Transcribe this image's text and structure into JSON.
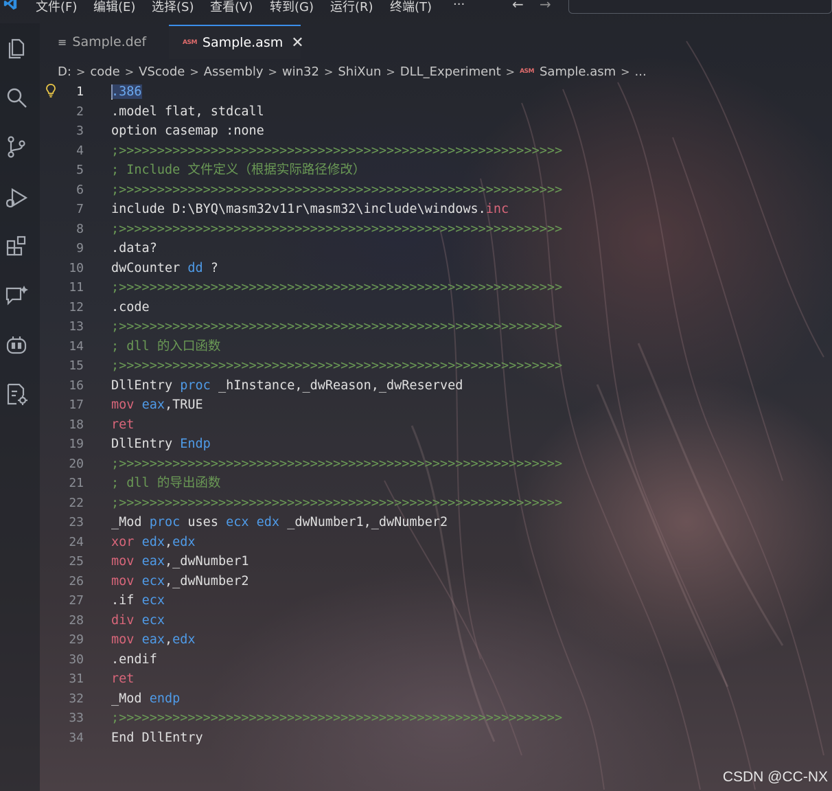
{
  "menu": {
    "items": [
      "文件(F)",
      "编辑(E)",
      "选择(S)",
      "查看(V)",
      "转到(G)",
      "运行(R)",
      "终端(T)",
      "···"
    ],
    "back": "←",
    "forward": "→"
  },
  "tabs": [
    {
      "label": "Sample.def",
      "active": false
    },
    {
      "label": "Sample.asm",
      "active": true,
      "badge": "ASM",
      "close": "✕"
    }
  ],
  "breadcrumb": {
    "items": [
      "D:",
      "code",
      "VScode",
      "Assembly",
      "win32",
      "ShiXun",
      "DLL_Experiment",
      "Sample.asm",
      "..."
    ],
    "separator": ">",
    "file_badge": "ASM"
  },
  "editor": {
    "current_line": 1,
    "lines": [
      {
        "n": "1",
        "tokens": [
          {
            "t": ".386",
            "c": "num",
            "sel": true
          }
        ]
      },
      {
        "n": "2",
        "tokens": [
          {
            "t": ".model flat, stdcall",
            "c": "plain"
          }
        ]
      },
      {
        "n": "3",
        "tokens": [
          {
            "t": "option casemap :none",
            "c": "plain"
          }
        ]
      },
      {
        "n": "4",
        "tokens": [
          {
            "t": ";>>>>>>>>>>>>>>>>>>>>>>>>>>>>>>>>>>>>>>>>>>>>>>>>>>>>>>>>>>",
            "c": "comment"
          }
        ]
      },
      {
        "n": "5",
        "tokens": [
          {
            "t": "; Include 文件定义（根据实际路径修改）",
            "c": "comment"
          }
        ]
      },
      {
        "n": "6",
        "tokens": [
          {
            "t": ";>>>>>>>>>>>>>>>>>>>>>>>>>>>>>>>>>>>>>>>>>>>>>>>>>>>>>>>>>>",
            "c": "comment"
          }
        ]
      },
      {
        "n": "7",
        "tokens": [
          {
            "t": "include D:\\BYQ\\masm32v11r\\masm32\\include\\windows.",
            "c": "plain"
          },
          {
            "t": "inc",
            "c": "ins"
          }
        ]
      },
      {
        "n": "8",
        "tokens": [
          {
            "t": ";>>>>>>>>>>>>>>>>>>>>>>>>>>>>>>>>>>>>>>>>>>>>>>>>>>>>>>>>>>",
            "c": "comment"
          }
        ]
      },
      {
        "n": "9",
        "tokens": [
          {
            "t": ".data?",
            "c": "plain"
          }
        ]
      },
      {
        "n": "10",
        "tokens": [
          {
            "t": "dwCounter ",
            "c": "plain"
          },
          {
            "t": "dd",
            "c": "kw"
          },
          {
            "t": " ?",
            "c": "plain"
          }
        ]
      },
      {
        "n": "11",
        "tokens": [
          {
            "t": ";>>>>>>>>>>>>>>>>>>>>>>>>>>>>>>>>>>>>>>>>>>>>>>>>>>>>>>>>>>",
            "c": "comment"
          }
        ]
      },
      {
        "n": "12",
        "tokens": [
          {
            "t": ".code",
            "c": "plain"
          }
        ]
      },
      {
        "n": "13",
        "tokens": [
          {
            "t": ";>>>>>>>>>>>>>>>>>>>>>>>>>>>>>>>>>>>>>>>>>>>>>>>>>>>>>>>>>>",
            "c": "comment"
          }
        ]
      },
      {
        "n": "14",
        "tokens": [
          {
            "t": "; dll 的入口函数",
            "c": "comment"
          }
        ]
      },
      {
        "n": "15",
        "tokens": [
          {
            "t": ";>>>>>>>>>>>>>>>>>>>>>>>>>>>>>>>>>>>>>>>>>>>>>>>>>>>>>>>>>>",
            "c": "comment"
          }
        ]
      },
      {
        "n": "16",
        "tokens": [
          {
            "t": "DllEntry ",
            "c": "plain"
          },
          {
            "t": "proc",
            "c": "kw"
          },
          {
            "t": " _hInstance,_dwReason,_dwReserved",
            "c": "plain"
          }
        ]
      },
      {
        "n": "17",
        "tokens": [
          {
            "t": "mov",
            "c": "ins"
          },
          {
            "t": " ",
            "c": "plain"
          },
          {
            "t": "eax",
            "c": "kw"
          },
          {
            "t": ",TRUE",
            "c": "plain"
          }
        ]
      },
      {
        "n": "18",
        "tokens": [
          {
            "t": "ret",
            "c": "ins"
          }
        ]
      },
      {
        "n": "19",
        "tokens": [
          {
            "t": "DllEntry ",
            "c": "plain"
          },
          {
            "t": "Endp",
            "c": "kw"
          }
        ]
      },
      {
        "n": "20",
        "tokens": [
          {
            "t": ";>>>>>>>>>>>>>>>>>>>>>>>>>>>>>>>>>>>>>>>>>>>>>>>>>>>>>>>>>>",
            "c": "comment"
          }
        ]
      },
      {
        "n": "21",
        "tokens": [
          {
            "t": "; dll 的导出函数",
            "c": "comment"
          }
        ]
      },
      {
        "n": "22",
        "tokens": [
          {
            "t": ";>>>>>>>>>>>>>>>>>>>>>>>>>>>>>>>>>>>>>>>>>>>>>>>>>>>>>>>>>>",
            "c": "comment"
          }
        ]
      },
      {
        "n": "23",
        "tokens": [
          {
            "t": "_Mod ",
            "c": "plain"
          },
          {
            "t": "proc",
            "c": "kw"
          },
          {
            "t": " uses ",
            "c": "plain"
          },
          {
            "t": "ecx",
            "c": "kw"
          },
          {
            "t": " ",
            "c": "plain"
          },
          {
            "t": "edx",
            "c": "kw"
          },
          {
            "t": " _dwNumber1,_dwNumber2",
            "c": "plain"
          }
        ]
      },
      {
        "n": "24",
        "tokens": [
          {
            "t": "xor",
            "c": "ins"
          },
          {
            "t": " ",
            "c": "plain"
          },
          {
            "t": "edx",
            "c": "kw"
          },
          {
            "t": ",",
            "c": "plain"
          },
          {
            "t": "edx",
            "c": "kw"
          }
        ]
      },
      {
        "n": "25",
        "tokens": [
          {
            "t": "mov",
            "c": "ins"
          },
          {
            "t": " ",
            "c": "plain"
          },
          {
            "t": "eax",
            "c": "kw"
          },
          {
            "t": ",_dwNumber1",
            "c": "plain"
          }
        ]
      },
      {
        "n": "26",
        "tokens": [
          {
            "t": "mov",
            "c": "ins"
          },
          {
            "t": " ",
            "c": "plain"
          },
          {
            "t": "ecx",
            "c": "kw"
          },
          {
            "t": ",_dwNumber2",
            "c": "plain"
          }
        ]
      },
      {
        "n": "27",
        "tokens": [
          {
            "t": ".if ",
            "c": "plain"
          },
          {
            "t": "ecx",
            "c": "kw"
          }
        ]
      },
      {
        "n": "28",
        "tokens": [
          {
            "t": "div",
            "c": "ins"
          },
          {
            "t": " ",
            "c": "plain"
          },
          {
            "t": "ecx",
            "c": "kw"
          }
        ]
      },
      {
        "n": "29",
        "tokens": [
          {
            "t": "mov",
            "c": "ins"
          },
          {
            "t": " ",
            "c": "plain"
          },
          {
            "t": "eax",
            "c": "kw"
          },
          {
            "t": ",",
            "c": "plain"
          },
          {
            "t": "edx",
            "c": "kw"
          }
        ]
      },
      {
        "n": "30",
        "tokens": [
          {
            "t": ".endif",
            "c": "plain"
          }
        ]
      },
      {
        "n": "31",
        "tokens": [
          {
            "t": "ret",
            "c": "ins"
          }
        ]
      },
      {
        "n": "32",
        "tokens": [
          {
            "t": "_Mod ",
            "c": "plain"
          },
          {
            "t": "endp",
            "c": "kw"
          }
        ]
      },
      {
        "n": "33",
        "tokens": [
          {
            "t": ";>>>>>>>>>>>>>>>>>>>>>>>>>>>>>>>>>>>>>>>>>>>>>>>>>>>>>>>>>>",
            "c": "comment"
          }
        ]
      },
      {
        "n": "34",
        "tokens": [
          {
            "t": "End DllEntry",
            "c": "plain"
          }
        ]
      }
    ]
  },
  "activity_icons": [
    "explorer-icon",
    "search-icon",
    "source-control-icon",
    "run-debug-icon",
    "extensions-icon",
    "chat-icon",
    "copilot-icon",
    "remote-settings-icon"
  ],
  "watermark": "CSDN @CC-NX",
  "colors": {
    "keyword": "#4f9be8",
    "instruction": "#d9667a",
    "comment": "#6a9955",
    "tab_accent": "#3b8eea"
  }
}
